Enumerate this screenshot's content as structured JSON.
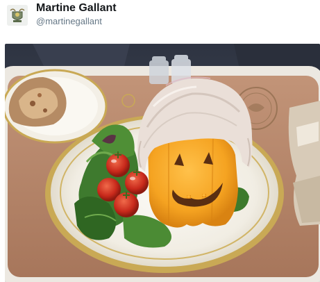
{
  "tweet": {
    "author": {
      "display_name": "Martine Gallant",
      "handle": "@martinegallant",
      "avatar_icon": "crest-avatar-icon"
    },
    "photo": {
      "subject": "salad-plate-with-jack-o-lantern-bell-pepper-and-wig",
      "colors": {
        "tray": "#b48366",
        "pepper": "#f5a321",
        "wig": "#eadfd8",
        "plate_rim": "#c9a955"
      }
    }
  }
}
